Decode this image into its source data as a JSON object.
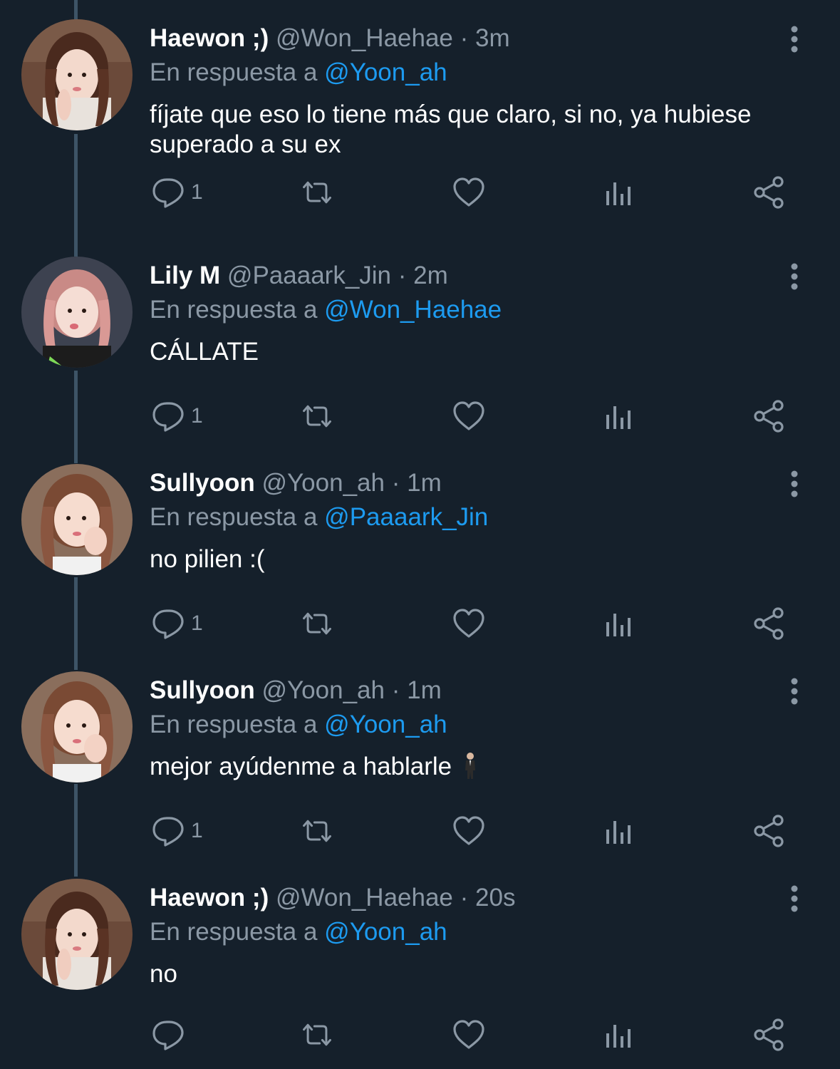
{
  "thread": {
    "reply_prefix": "En respuesta a",
    "tweets": [
      {
        "name": "Haewon ;)",
        "handle": "@Won_Haehae",
        "separator": "·",
        "time": "3m",
        "reply_to": "@Yoon_ah",
        "text": "fíjate que eso lo tiene más que claro, si no, ya hubiese superado a su ex",
        "reply_count": "1",
        "avatar": "haewon"
      },
      {
        "name": "Lily M",
        "handle": "@Paaaark_Jin",
        "separator": "·",
        "time": "2m",
        "reply_to": "@Won_Haehae",
        "text": "CÁLLATE",
        "reply_count": "1",
        "avatar": "lily"
      },
      {
        "name": "Sullyoon",
        "handle": "@Yoon_ah",
        "separator": "·",
        "time": "1m",
        "reply_to": "@Paaaark_Jin",
        "text": "no pilien :(",
        "reply_count": "1",
        "avatar": "sullyoon"
      },
      {
        "name": "Sullyoon",
        "handle": "@Yoon_ah",
        "separator": "·",
        "time": "1m",
        "reply_to": "@Yoon_ah",
        "text": "mejor ayúdenme a hablarle",
        "reply_count": "1",
        "avatar": "sullyoon"
      },
      {
        "name": "Haewon ;)",
        "handle": "@Won_Haehae",
        "separator": "·",
        "time": "20s",
        "reply_to": "@Yoon_ah",
        "text": "no",
        "reply_count": "",
        "avatar": "haewon"
      }
    ]
  },
  "colors": {
    "background": "#15202b",
    "text": "#ffffff",
    "secondary": "#8b98a5",
    "mention": "#1d9bf0",
    "thread_line": "#3d5466"
  },
  "icons": {
    "reply": "comment-bubble-icon",
    "retweet": "retweet-arrows-icon",
    "like": "heart-icon",
    "views": "analytics-bars-icon",
    "share": "share-nodes-icon",
    "more": "vertical-dots-icon",
    "emoji": "person-in-suit-emoji"
  }
}
